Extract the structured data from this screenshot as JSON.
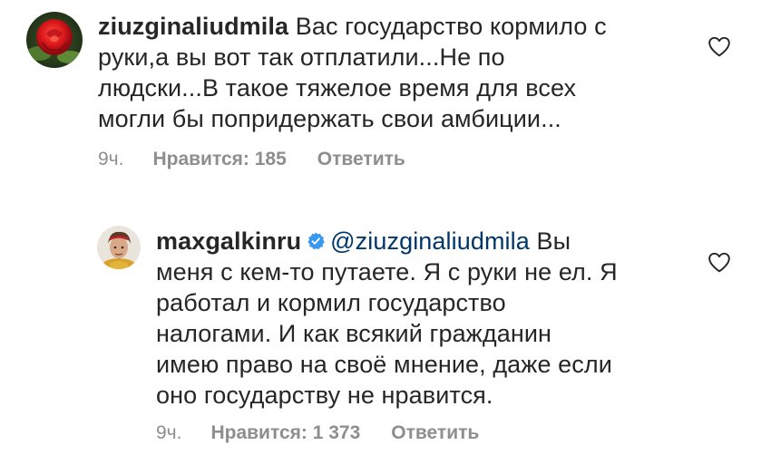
{
  "comments": [
    {
      "username": "ziuzginaliudmila",
      "text_lines": [
        "Вас государство кормило с",
        "руки,а вы вот так отплатили...Не по",
        "людски...В такое тяжелое время для всех",
        "могли бы попридержать свои амбиции..."
      ],
      "time": "9ч.",
      "likes": "Нравится: 185",
      "reply": "Ответить",
      "avatar_icon": "rose-photo-avatar",
      "like_icon": "heart-outline-icon"
    },
    {
      "username": "maxgalkinru",
      "verified_icon": "verified-badge-icon",
      "mention": "@ziuzginaliudmila",
      "text_first": "Вы",
      "text_lines": [
        "меня с кем-то путаете. Я с руки не ел. Я",
        "работал и кормил государство",
        "налогами. И как всякий гражданин",
        "имею право на своё мнение, даже если",
        "оно государству не нравится."
      ],
      "time": "9ч.",
      "likes": "Нравится: 1 373",
      "reply": "Ответить",
      "avatar_icon": "person-photo-avatar",
      "like_icon": "heart-outline-icon"
    }
  ],
  "colors": {
    "text": "#262626",
    "secondary": "#8e8e8e",
    "mention": "#00376b",
    "verified": "#3897f0"
  }
}
